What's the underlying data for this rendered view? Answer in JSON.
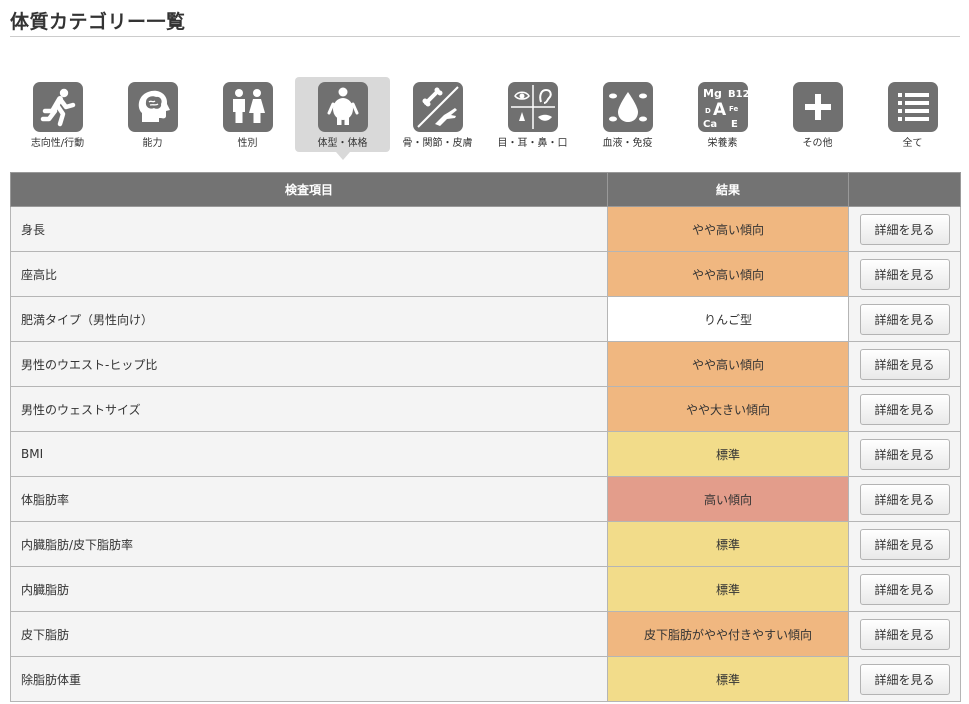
{
  "header": {
    "title": "体質カテゴリー一覧"
  },
  "categories": [
    {
      "label": "志向性/行動",
      "icon": "running-person-icon"
    },
    {
      "label": "能力",
      "icon": "brain-head-icon"
    },
    {
      "label": "性別",
      "icon": "male-female-icon"
    },
    {
      "label": "体型・体格",
      "icon": "body-shape-icon",
      "active": true
    },
    {
      "label": "骨・関節・皮膚",
      "icon": "bone-arm-icon"
    },
    {
      "label": "目・耳・鼻・口",
      "icon": "eye-ear-nose-mouth-icon"
    },
    {
      "label": "血液・免疫",
      "icon": "blood-drop-icon"
    },
    {
      "label": "栄養素",
      "icon": "nutrients-icon",
      "icon_text": [
        "Mg",
        "B12",
        "D",
        "A",
        "Fe",
        "Ca",
        "E"
      ]
    },
    {
      "label": "その他",
      "icon": "plus-icon"
    },
    {
      "label": "全て",
      "icon": "list-icon"
    }
  ],
  "table": {
    "headers": {
      "item": "検査項目",
      "result": "結果",
      "action": ""
    },
    "button_label": "詳細を見る",
    "rows": [
      {
        "item": "身長",
        "result": "やや高い傾向",
        "level": "high"
      },
      {
        "item": "座高比",
        "result": "やや高い傾向",
        "level": "high"
      },
      {
        "item": "肥満タイプ（男性向け）",
        "result": "りんご型",
        "level": "white"
      },
      {
        "item": "男性のウエスト-ヒップ比",
        "result": "やや高い傾向",
        "level": "high"
      },
      {
        "item": "男性のウェストサイズ",
        "result": "やや大きい傾向",
        "level": "high"
      },
      {
        "item": "BMI",
        "result": "標準",
        "level": "std"
      },
      {
        "item": "体脂肪率",
        "result": "高い傾向",
        "level": "vhigh"
      },
      {
        "item": "内臓脂肪/皮下脂肪率",
        "result": "標準",
        "level": "std"
      },
      {
        "item": "内臓脂肪",
        "result": "標準",
        "level": "std"
      },
      {
        "item": "皮下脂肪",
        "result": "皮下脂肪がやや付きやすい傾向",
        "level": "high"
      },
      {
        "item": "除脂肪体重",
        "result": "標準",
        "level": "std"
      }
    ]
  },
  "colors": {
    "high": "#f0b780",
    "std": "#f2dc8a",
    "vhigh": "#e39d8b",
    "white": "#ffffff",
    "header": "#737373",
    "icon": "#707070"
  }
}
